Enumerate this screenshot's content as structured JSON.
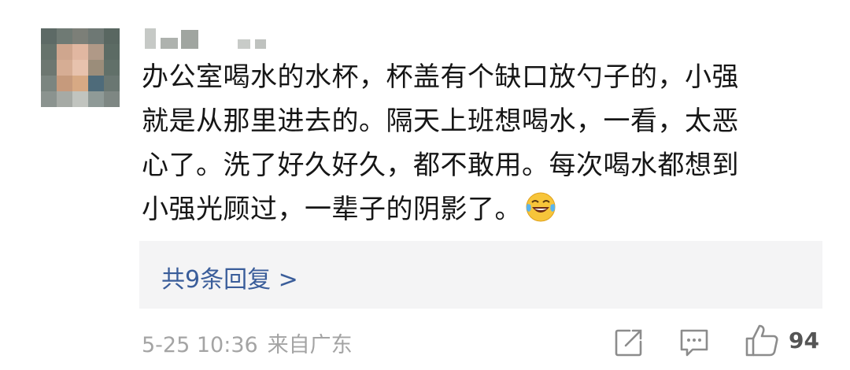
{
  "comment": {
    "lines": [
      "办公室喝水的水杯，杯盖有个缺口放勺子的，小强",
      "就是从那里进去的。隔天上班想喝水，一看，太恶",
      "心了。洗了好久好久，都不敢用。每次喝水都想到",
      "小强光顾过，一辈子的阴影了。"
    ],
    "emoji": "laughing-tears-emoji"
  },
  "replies": {
    "label": "共9条回复 >"
  },
  "footer": {
    "date": "5-25 10:36",
    "location": "来自广东"
  },
  "actions": {
    "share_icon": "share-icon",
    "comment_icon": "comment-icon",
    "like_icon": "thumbs-up-icon",
    "like_count": "94"
  },
  "colors": {
    "link": "#3a5d9a",
    "reply_bg": "#f4f4f5",
    "meta": "#a4a4a4"
  }
}
